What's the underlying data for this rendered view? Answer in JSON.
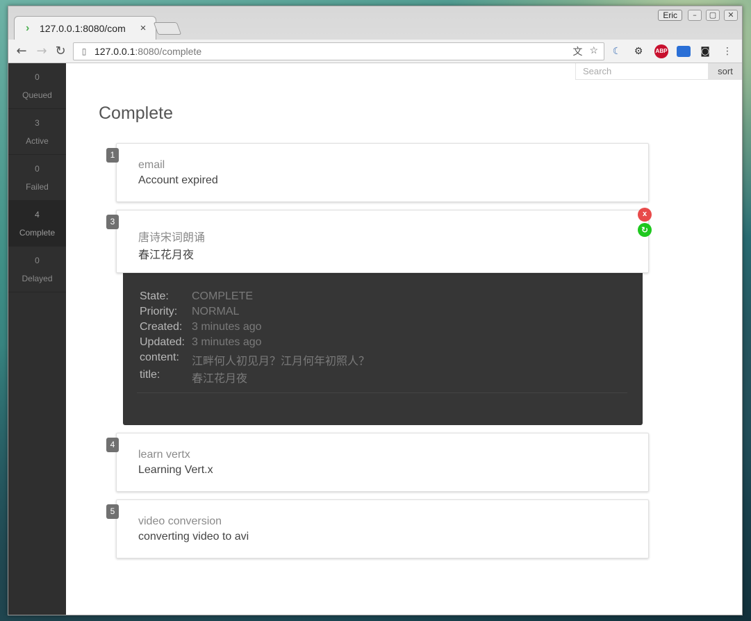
{
  "browser": {
    "tab_title": "127.0.0.1:8080/com",
    "tab_close": "×",
    "url_host": "127.0.0.1",
    "url_path": ":8080/complete",
    "user_name": "Eric"
  },
  "sidebar": {
    "items": [
      {
        "count": "0",
        "label": "Queued"
      },
      {
        "count": "3",
        "label": "Active"
      },
      {
        "count": "0",
        "label": "Failed"
      },
      {
        "count": "4",
        "label": "Complete"
      },
      {
        "count": "0",
        "label": "Delayed"
      }
    ]
  },
  "search": {
    "placeholder": "Search"
  },
  "sort_label": "sort",
  "page_title": "Complete",
  "jobs": [
    {
      "id": "1",
      "type": "email",
      "title": "Account expired"
    },
    {
      "id": "3",
      "type": "唐诗宋词朗诵",
      "title": "春江花月夜",
      "remove": "x",
      "restart": "↻"
    },
    {
      "id": "4",
      "type": "learn vertx",
      "title": "Learning Vert.x"
    },
    {
      "id": "5",
      "type": "video conversion",
      "title": "converting video to avi"
    }
  ],
  "details": {
    "state_label": "State:",
    "state_value": "COMPLETE",
    "priority_label": "Priority:",
    "priority_value": "NORMAL",
    "created_label": "Created:",
    "created_value": "3 minutes ago",
    "updated_label": "Updated:",
    "updated_value": "3 minutes ago",
    "content_label": "content:",
    "content_value": "江畔何人初见月？江月何年初照人？",
    "title_label": "title:",
    "title_value": "春江花月夜"
  }
}
